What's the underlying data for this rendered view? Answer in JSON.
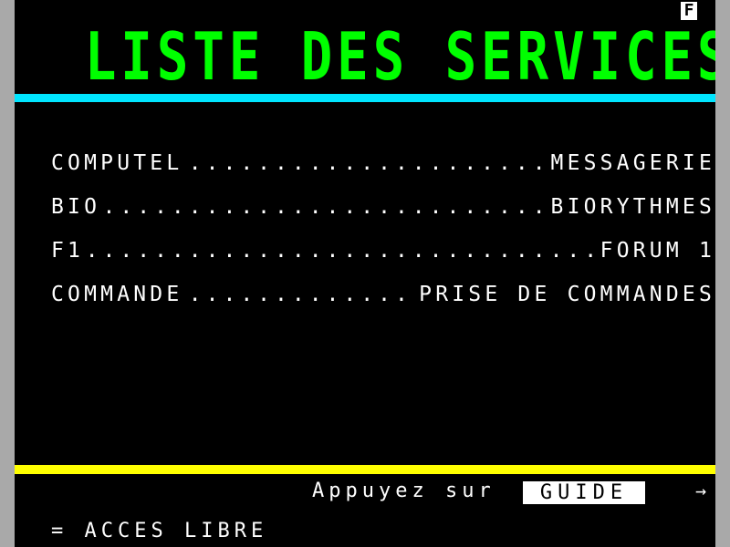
{
  "status_indicator": "F",
  "title": "LISTE DES SERVICES",
  "services": [
    {
      "code": "COMPUTEL",
      "description": "MESSAGERIE"
    },
    {
      "code": "BIO",
      "description": "BIORYTHMES"
    },
    {
      "code": "F1",
      "description": "FORUM 1"
    },
    {
      "code": "COMMANDE",
      "description": "PRISE DE COMMANDES"
    }
  ],
  "dot_leader": "..................................................................",
  "footer": {
    "prompt": "Appuyez sur",
    "guide_key": "GUIDE",
    "arrow": "→"
  },
  "access_text": "= ACCES LIBRE",
  "colors": {
    "title": "#00ff00",
    "top_rule": "#00e5ff",
    "bottom_rule": "#ffff00",
    "background": "#000000",
    "text": "#ffffff"
  }
}
